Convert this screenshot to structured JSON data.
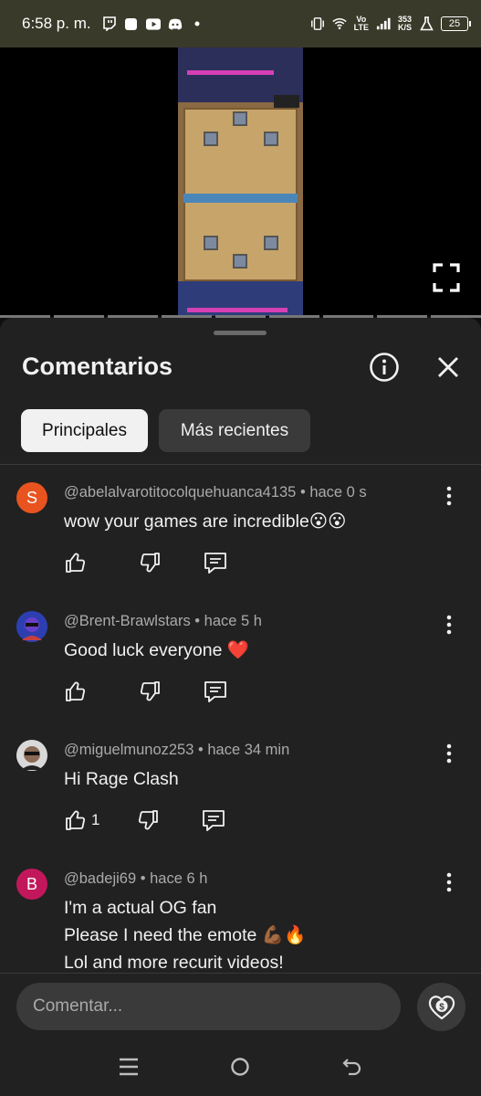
{
  "status_bar": {
    "time": "6:58 p. m.",
    "network_speed_value": "353",
    "network_speed_unit": "K/S",
    "volte_top": "Vo",
    "volte_bottom": "LTE",
    "battery": "25"
  },
  "sheet": {
    "title": "Comentarios"
  },
  "filters": {
    "top": "Principales",
    "newest": "Más recientes"
  },
  "comments": [
    {
      "avatar_letter": "S",
      "avatar_color": "#e8531f",
      "author": "@abelalvarotitocolquehuanca4135",
      "time": "hace 0 s",
      "lines": [
        "wow your games are incredible😮😮"
      ],
      "likes": ""
    },
    {
      "avatar_letter": "",
      "avatar_color": "#2d3fb0",
      "author": "@Brent-Brawlstars",
      "time": "hace 5 h",
      "lines": [
        "Good luck everyone ❤️"
      ],
      "likes": ""
    },
    {
      "avatar_letter": "",
      "avatar_color": "#5a5a5a",
      "author": "@miguelmunoz253",
      "time": "hace 34 min",
      "lines": [
        "Hi Rage Clash"
      ],
      "likes": "1"
    },
    {
      "avatar_letter": "B",
      "avatar_color": "#c2185b",
      "author": "@badeji69",
      "time": "hace 6 h",
      "lines": [
        "I'm a actual OG fan",
        "Please I need the emote 💪🏾🔥",
        "Lol and more recurit videos!"
      ],
      "likes": ""
    }
  ],
  "compose": {
    "placeholder": "Comentar..."
  },
  "icons": {
    "status": [
      "twitch-icon",
      "notification-square-icon",
      "youtube-icon",
      "discord-icon",
      "vibrate-icon",
      "wifi-icon",
      "signal-icon",
      "lab-icon",
      "battery-icon"
    ],
    "comment_actions": [
      "thumbs-up-icon",
      "thumbs-down-icon",
      "reply-icon"
    ],
    "header": [
      "info-icon",
      "close-icon"
    ],
    "nav": [
      "recents-icon",
      "home-icon",
      "back-icon"
    ]
  }
}
